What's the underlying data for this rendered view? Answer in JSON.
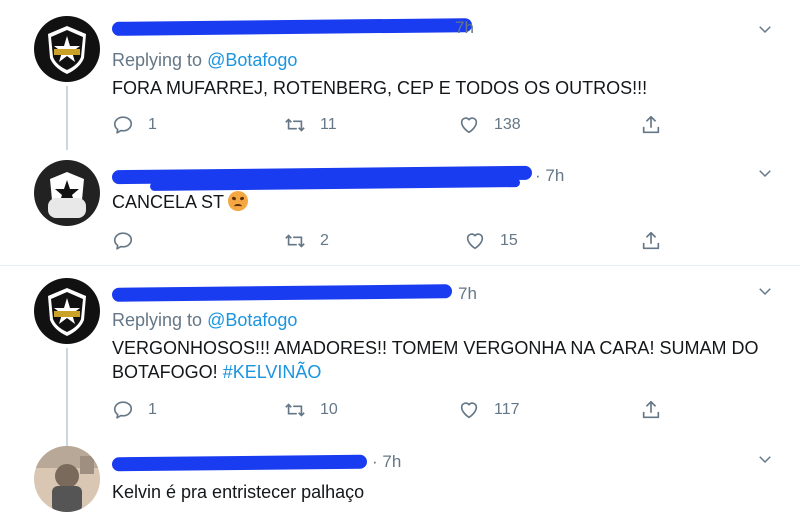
{
  "tweets": [
    {
      "time": "7h",
      "replying_prefix": "Replying to",
      "replying_handle": "@Botafogo",
      "text": "FORA MUFARREJ, ROTENBERG, CEP E TODOS OS OUTROS!!!",
      "replies": "1",
      "retweets": "11",
      "likes": "138"
    },
    {
      "time": "· 7h",
      "text": "CANCELA ST",
      "replies": "",
      "retweets": "2",
      "likes": "15"
    },
    {
      "time": "7h",
      "replying_prefix": "Replying to",
      "replying_handle": "@Botafogo",
      "text_line1": "VERGONHOSOS!!! AMADORES!! TOMEM VERGONHA NA CARA! SUMAM DO",
      "text_line2": "BOTAFOGO!",
      "hashtag": "#KELVINÃO",
      "replies": "1",
      "retweets": "10",
      "likes": "117"
    },
    {
      "time": "· 7h",
      "text": "Kelvin é pra entristecer palhaço"
    }
  ],
  "icons": {
    "reply": "reply-icon",
    "retweet": "retweet-icon",
    "like": "heart-icon",
    "share": "share-icon",
    "more": "chevron-down-icon",
    "emoji": "angry-face-emoji"
  },
  "colors": {
    "link": "#1b95e0",
    "muted": "#657786",
    "scribble": "#1a3cf0"
  }
}
